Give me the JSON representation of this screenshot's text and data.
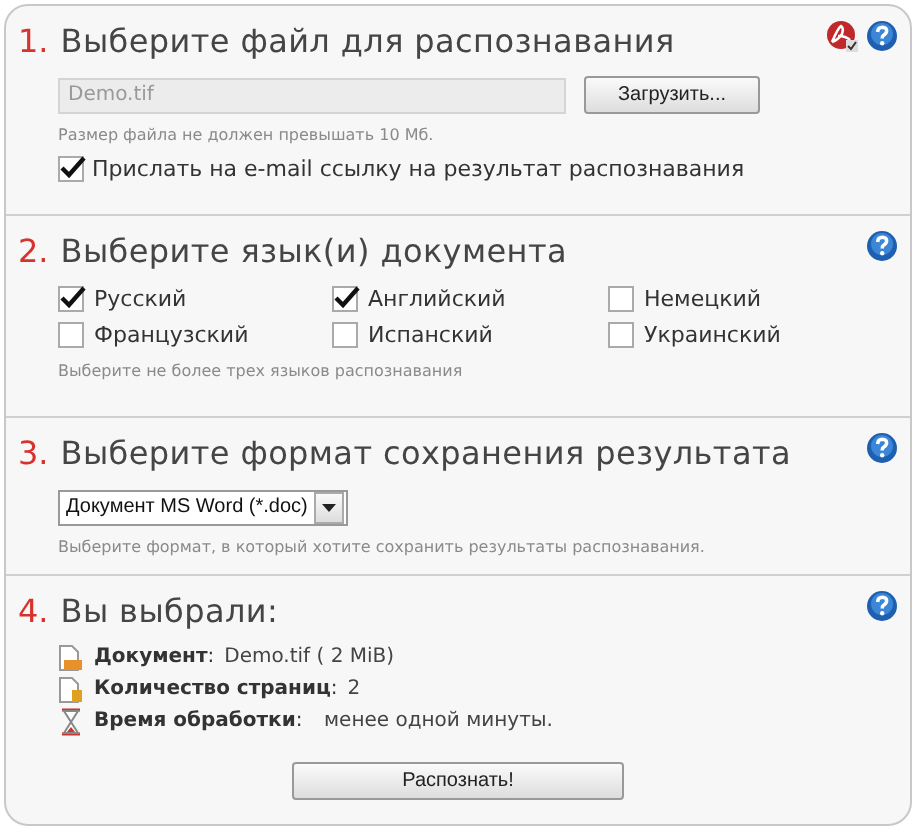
{
  "sections": [
    {
      "number": "1.",
      "title": "Выберите файл для распознавания",
      "kind": "file",
      "icons": [
        {
          "kind": "pdf"
        },
        {
          "kind": "help"
        }
      ],
      "file_field": {
        "value": "Demo.tif",
        "disabled": true
      },
      "upload_button": "Загрузить...",
      "hint": "Размер файла не должен превышать 10 Мб.",
      "email_option": {
        "label": "Прислать на e-mail ссылку на результат распознавания",
        "checked": true
      }
    },
    {
      "number": "2.",
      "title": "Выберите язык(и) документа",
      "kind": "languages",
      "icons": [
        {
          "kind": "help"
        }
      ],
      "languages": [
        {
          "label": "Русский",
          "checked": true
        },
        {
          "label": "Английский",
          "checked": true
        },
        {
          "label": "Немецкий",
          "checked": false
        },
        {
          "label": "Французский",
          "checked": false
        },
        {
          "label": "Испанский",
          "checked": false
        },
        {
          "label": "Украинский",
          "checked": false
        }
      ],
      "hint": "Выберите не более трех языков распознавания"
    },
    {
      "number": "3.",
      "title": "Выберите формат сохранения результата",
      "kind": "format",
      "icons": [
        {
          "kind": "help"
        }
      ],
      "format_select": {
        "value": "Документ MS Word (*.doc)"
      },
      "hint": "Выберите формат, в который хотите сохранить результаты распознавания."
    },
    {
      "number": "4.",
      "title": "Вы выбрали:",
      "kind": "summary",
      "icons": [
        {
          "kind": "help"
        }
      ],
      "summary": [
        {
          "kind": "document",
          "label": "**Документ**:",
          "value": "Demo.tif  ( 2 MiB)"
        },
        {
          "kind": "pages",
          "label": "**Количество страниц**:",
          "value": "2"
        },
        {
          "kind": "time",
          "label": "**Время обработки**:",
          "value": "менее одной минуты."
        }
      ],
      "submit_button": "Распознать!"
    }
  ]
}
